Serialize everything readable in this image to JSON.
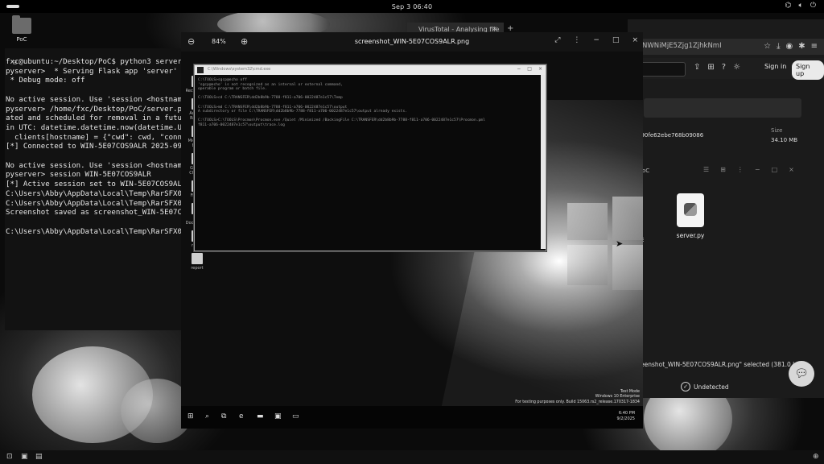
{
  "topbar": {
    "clock": "Sep 3  06:40"
  },
  "desktop": {
    "folder_label": "PoC"
  },
  "terminal": {
    "lines": [
      "fxc@ubuntu:~/Desktop/PoC$ python3 server.",
      "pyserver>  * Serving Flask app 'server'",
      " * Debug mode: off",
      "",
      "No active session. Use 'session <hostname",
      "pyserver> /home/fxc/Desktop/PoC/server.py",
      "ated and scheduled for removal in a futur",
      "in UTC: datetime.datetime.now(datetime.UT",
      "  clients[hostname] = {\"cwd\": cwd, \"conne",
      "[*] Connected to WIN-5E07COS9ALR 2025-09-",
      "",
      "No active session. Use 'session <hostname",
      "pyserver> session WIN-5E07COS9ALR",
      "[*] Active session set to WIN-5E07COS9ALR",
      "C:\\Users\\Abby\\AppData\\Local\\Temp\\RarSFX0>",
      "C:\\Users\\Abby\\AppData\\Local\\Temp\\RarSFX0>",
      "Screenshot saved as screenshot_WIN-5E07CC",
      "",
      "C:\\Users\\Abby\\AppData\\Local\\Temp\\RarSFX0>"
    ]
  },
  "browser": {
    "tab_label": "VirusTotal - Analysing file",
    "tab_close": "×",
    "new_tab": "+",
    "url_fragment": "NWNiMjE5Zjg1ZjhkNmI",
    "sign_in": "Sign in",
    "sign_up": "Sign up",
    "hash_fragment": "090fe62ebe768b09086",
    "size_label": "Size",
    "size_value": "34.10 MB",
    "subwindow_label": "oC",
    "file_name": "server.py",
    "letter_e": "E",
    "selected_status": "eenshot_WIN-5E07COS9ALR.png\" selected (381.0 kB)",
    "detection_prefix": "t",
    "detection_result": "Undetected"
  },
  "viewer": {
    "zoom": "84%",
    "title": "screenshot_WIN-5E07COS9ALR.png"
  },
  "screenshot": {
    "cmd_title": "C:\\Windows\\system32\\cmd.exe",
    "cmd_lines": [
      "C:\\TOOLS>sgcp@echo off",
      "'sgcp@echo' is not recognized as an internal or external command,",
      "operable program or batch file.",
      "",
      "C:\\TOOLS>cd C:\\TRANSFER\\dd2b8b9b-7788-f811-a706-0022487e1c57\\Temp",
      "",
      "C:\\TOOLS>md C:\\TRANSFER\\dd2b8b9b-7788-f811-a706-0022487e1c57\\output",
      "A subdirectory or file C:\\TRANSFER\\dd2b8b9b-7788-f811-a706-0022487e1c57\\output already exists.",
      "",
      "C:\\TOOLS>C:\\TOOLS\\Procmon\\Procmon.exe /Quiet /Minimized /BackingFile C:\\TRANSFER\\dd2b8b9b-7788-f811-a706-0022487e1c57\\Procmon.pml",
      "f811-a706-0022487e1c57\\output\\trace.log"
    ],
    "desktop_icons": [
      "Recycle Bin",
      "Acrobat Reader",
      "Microsoft Edge",
      "Google Chrome",
      "Firefox",
      "My Documents",
      "notes",
      "report"
    ],
    "watermark": [
      "Test Mode",
      "Windows 10 Enterprise",
      "For testing purposes only. Build 15063.rs2_release.170317-1834"
    ],
    "tray_time": "6:40 PM",
    "tray_date": "9/2/2025"
  }
}
